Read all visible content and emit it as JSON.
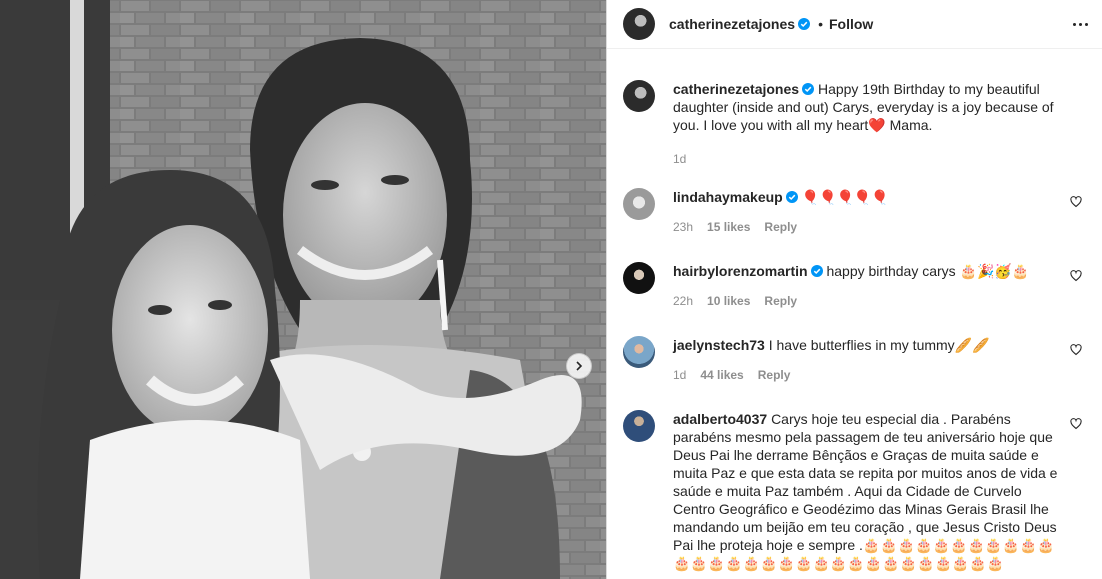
{
  "post": {
    "author": "catherinezetajones",
    "follow_label": "Follow",
    "dot": "•"
  },
  "caption": {
    "username": "catherinezetajones",
    "text": "Happy 19th Birthday to my beautiful daughter (inside and out) Carys, everyday is a joy because of you. I love you with all my heart❤️ Mama.",
    "age": "1d"
  },
  "comments": [
    {
      "username": "lindahaymakeup",
      "text": "🎈🎈🎈🎈🎈",
      "age": "23h",
      "likes": "15 likes",
      "reply": "Reply"
    },
    {
      "username": "hairbylorenzomartin",
      "text": "happy birthday carys 🎂🎉🥳🎂",
      "age": "22h",
      "likes": "10 likes",
      "reply": "Reply"
    },
    {
      "username": "jaelynstech73",
      "text": "I have butterflies in my tummy🥖🥖",
      "age": "1d",
      "likes": "44 likes",
      "reply": "Reply"
    },
    {
      "username": "adalberto4037",
      "text": "Carys hoje teu especial dia . Parabéns parabéns mesmo pela passagem de teu aniversário hoje que Deus Pai lhe derrame Bênçãos e Graças de muita saúde e muita Paz e que esta data se repita por muitos anos de vida e saúde e muita Paz também . Aqui da Cidade de Curvelo Centro Geográfico e Geodézimo das Minas Gerais Brasil lhe mandando um beijão em teu coração , que Jesus Cristo Deus Pai lhe proteja hoje e sempre .🎂🎂🎂🎂🎂🎂🎂🎂🎂🎂🎂🎂🎂🎂🎂🎂🎂🎂🎂🎂🎂🎂🎂🎂🎂🎂🎂🎂🎂🎂"
    }
  ],
  "colors": {
    "verified": "#0095f6",
    "meta_gray": "#8e8e8e",
    "text": "#262626",
    "border": "#dbdbdb"
  },
  "icons": {
    "verified": "verified-badge-icon",
    "heart": "heart-outline-icon",
    "more": "more-options-icon",
    "next": "chevron-right-icon"
  }
}
